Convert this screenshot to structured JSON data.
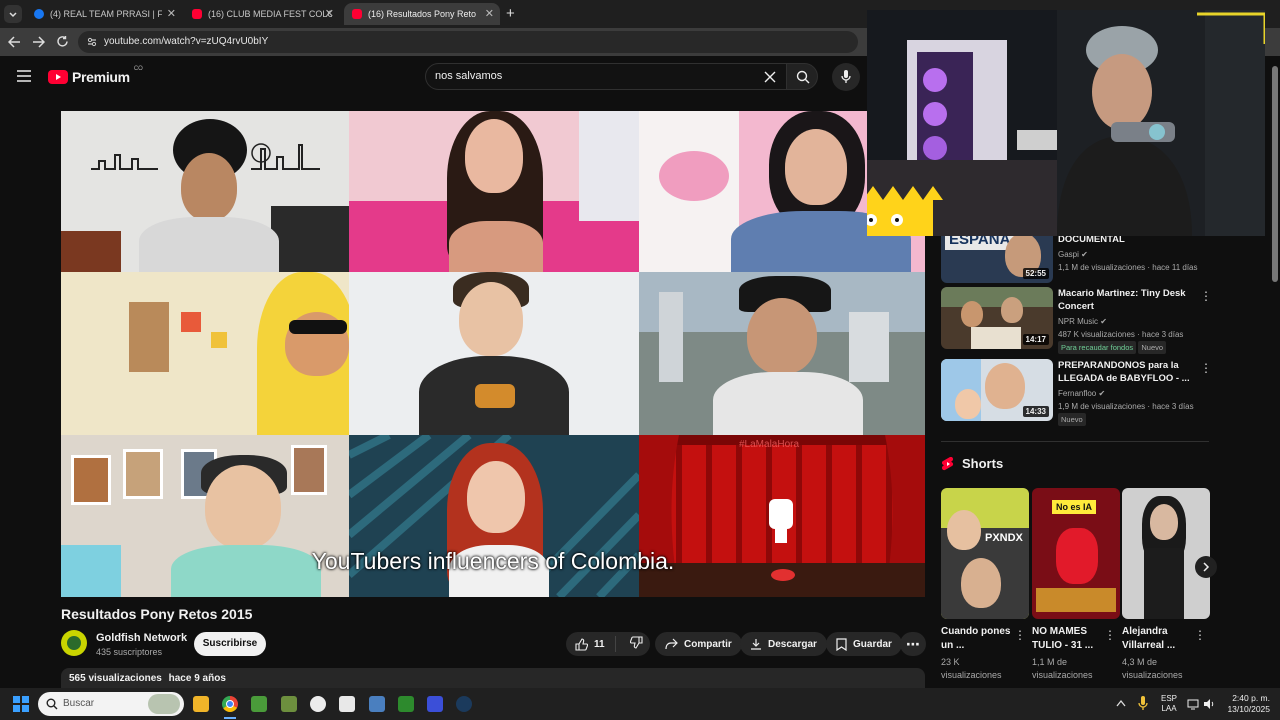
{
  "browser": {
    "tabs": [
      {
        "label": "(4) REAL TEAM PRRASI | Facebo",
        "active": false
      },
      {
        "label": "(16) CLUB MEDIA FEST COLOM",
        "active": false
      },
      {
        "label": "(16) Resultados Pony Retos 201",
        "active": true
      }
    ],
    "new_tab": "+",
    "url": "youtube.com/watch?v=zUQ4rvU0bIY"
  },
  "yt": {
    "logo_text": "Premium",
    "country": "CO",
    "search_value": "nos salvamos"
  },
  "video": {
    "caption": "YouTubers influencers of Colombia.",
    "title": "Resultados Pony Retos 2015",
    "channel": "Goldfish Network",
    "subscribers": "435 suscriptores",
    "subscribe_label": "Suscribirse",
    "likes": "11",
    "share_label": "Compartir",
    "download_label": "Descargar",
    "save_label": "Guardar",
    "more_label": "⋯",
    "views": "565 visualizaciones",
    "age": "hace 9 años",
    "stage_overlay": "#LaMalaHora"
  },
  "sidebar": {
    "items": [
      {
        "title": "DOCUMENTAL",
        "channel": "Gaspi",
        "stats": "1,1 M de visualizaciones · hace 11 días",
        "duration": "52:55",
        "thumb_text": "ESPAÑA",
        "badges": []
      },
      {
        "title": "Macario Martinez: Tiny Desk Concert",
        "channel": "NPR Music",
        "stats": "487 K visualizaciones · hace 3 días",
        "duration": "14:17",
        "badges": [
          "Para recaudar fondos",
          "Nuevo"
        ]
      },
      {
        "title": "PREPARANDONOS para la LLEGADA de BABYFLOO - ...",
        "channel": "Fernanfloo",
        "stats": "1,9 M de visualizaciones · hace 3 días",
        "duration": "14:33",
        "badges": [
          "Nuevo"
        ]
      }
    ],
    "shorts_heading": "Shorts",
    "shorts": [
      {
        "title": "Cuando pones un ...",
        "views": "23 K visualizaciones",
        "thumb_text": "PXNDX"
      },
      {
        "title": "NO MAMES TULIO - 31 ...",
        "views": "1,1 M de visualizaciones",
        "thumb_text": "No es IA"
      },
      {
        "title": "Alejandra Villarreal ...",
        "views": "4,3 M de visualizaciones"
      }
    ]
  },
  "taskbar": {
    "search_placeholder": "Buscar",
    "lang": "ESP",
    "lang_sub": "LAA",
    "time": "2:40 p. m.",
    "date": "13/10/2025"
  },
  "colors": {
    "yt_red": "#ff0033",
    "taskbar_accent": "#0078d4"
  }
}
